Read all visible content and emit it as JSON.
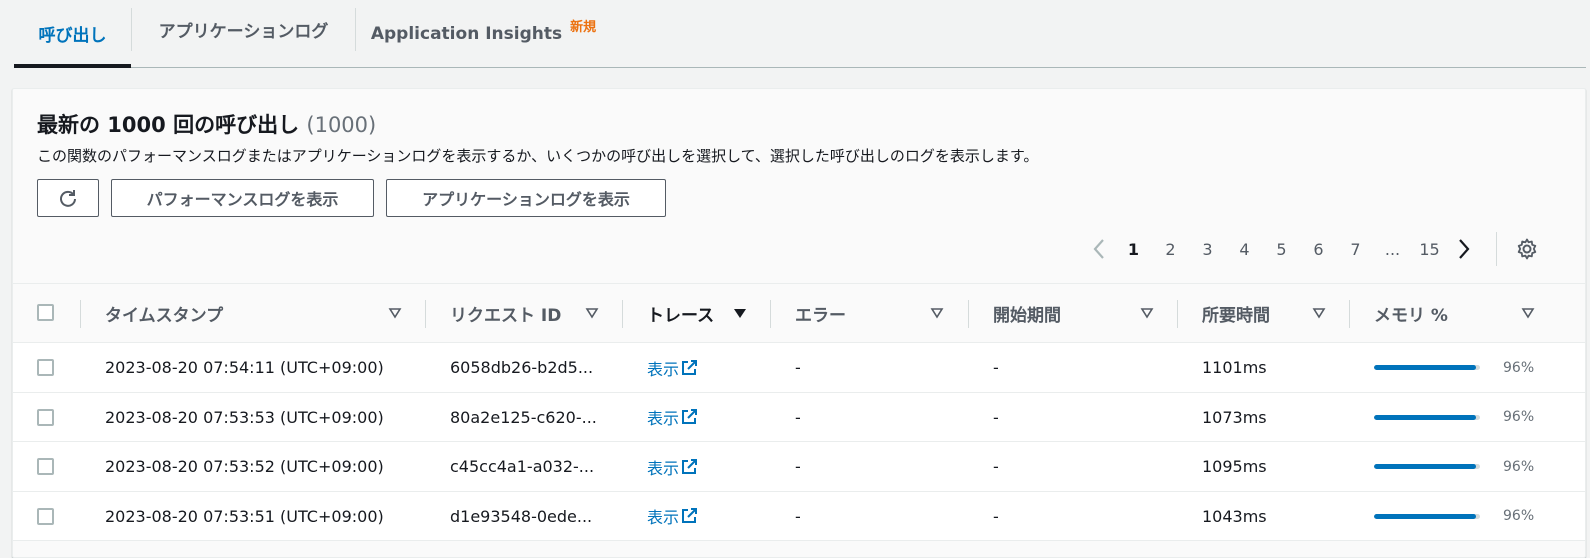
{
  "tabs": [
    {
      "label": "呼び出し",
      "active": true
    },
    {
      "label": "アプリケーションログ",
      "active": false
    },
    {
      "label": "Application Insights",
      "badge": "新規",
      "active": false
    }
  ],
  "panel": {
    "title": "最新の 1000 回の呼び出し",
    "count": "(1000)",
    "description": "この関数のパフォーマンスログまたはアプリケーションログを表示するか、いくつかの呼び出しを選択して、選択した呼び出しのログを表示します。",
    "buttons": {
      "refresh_icon": "refresh-icon",
      "performance_logs": "パフォーマンスログを表示",
      "application_logs": "アプリケーションログを表示"
    }
  },
  "pagination": {
    "pages": [
      "1",
      "2",
      "3",
      "4",
      "5",
      "6",
      "7",
      "...",
      "15"
    ],
    "current": "1"
  },
  "table": {
    "columns": [
      "タイムスタンプ",
      "リクエスト ID",
      "トレース",
      "エラー",
      "開始期間",
      "所要時間",
      "メモリ %"
    ],
    "sorted_column": "トレース",
    "rows": [
      {
        "timestamp": "2023-08-20 07:54:11 (UTC+09:00)",
        "request_id": "6058db26-b2d5...",
        "trace": "表示",
        "error": "-",
        "init": "-",
        "duration": "1101ms",
        "memory_pct": 96,
        "memory_label": "96%"
      },
      {
        "timestamp": "2023-08-20 07:53:53 (UTC+09:00)",
        "request_id": "80a2e125-c620-...",
        "trace": "表示",
        "error": "-",
        "init": "-",
        "duration": "1073ms",
        "memory_pct": 96,
        "memory_label": "96%"
      },
      {
        "timestamp": "2023-08-20 07:53:52 (UTC+09:00)",
        "request_id": "c45cc4a1-a032-...",
        "trace": "表示",
        "error": "-",
        "init": "-",
        "duration": "1095ms",
        "memory_pct": 96,
        "memory_label": "96%"
      },
      {
        "timestamp": "2023-08-20 07:53:51 (UTC+09:00)",
        "request_id": "d1e93548-0ede...",
        "trace": "表示",
        "error": "-",
        "init": "-",
        "duration": "1043ms",
        "memory_pct": 96,
        "memory_label": "96%"
      }
    ]
  },
  "colors": {
    "accent": "#0073bb",
    "badge": "#ec7211",
    "text": "#16191f",
    "muted": "#545b64"
  }
}
